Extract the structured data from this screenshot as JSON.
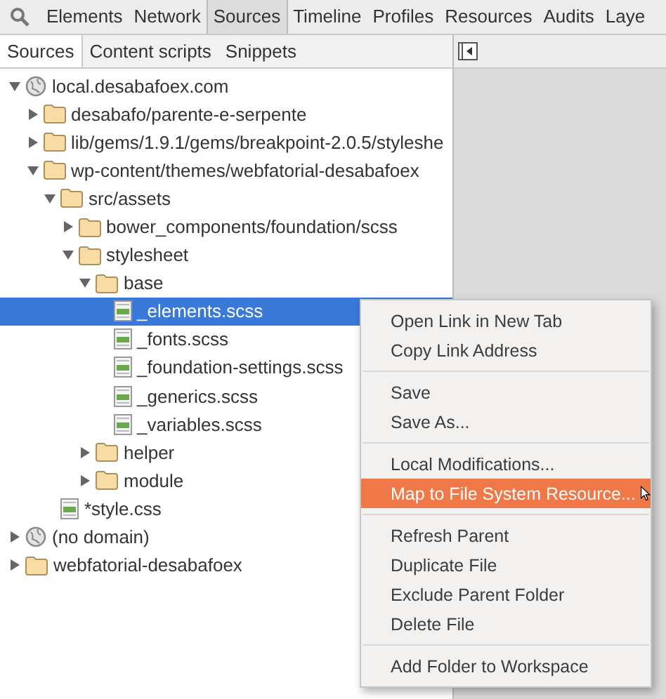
{
  "toolbar": {
    "tabs": [
      {
        "label": "Elements",
        "selected": false
      },
      {
        "label": "Network",
        "selected": false
      },
      {
        "label": "Sources",
        "selected": true
      },
      {
        "label": "Timeline",
        "selected": false
      },
      {
        "label": "Profiles",
        "selected": false
      },
      {
        "label": "Resources",
        "selected": false
      },
      {
        "label": "Audits",
        "selected": false
      },
      {
        "label": "Laye",
        "selected": false
      }
    ]
  },
  "navigator": {
    "tabs": [
      {
        "label": "Sources",
        "selected": true
      },
      {
        "label": "Content scripts",
        "selected": false
      },
      {
        "label": "Snippets",
        "selected": false
      }
    ],
    "tree": [
      {
        "kind": "domain",
        "label": "local.desabafoex.com",
        "expanded": true,
        "selected": false,
        "children": [
          {
            "kind": "folder",
            "label": "desabafo/parente-e-serpente",
            "expanded": false,
            "selected": false
          },
          {
            "kind": "folder",
            "label": "lib/gems/1.9.1/gems/breakpoint-2.0.5/styleshe",
            "expanded": false,
            "selected": false
          },
          {
            "kind": "folder",
            "label": "wp-content/themes/webfatorial-desabafoex",
            "expanded": true,
            "selected": false,
            "children": [
              {
                "kind": "folder",
                "label": "src/assets",
                "expanded": true,
                "selected": false,
                "children": [
                  {
                    "kind": "folder",
                    "label": "bower_components/foundation/scss",
                    "expanded": false,
                    "selected": false
                  },
                  {
                    "kind": "folder",
                    "label": "stylesheet",
                    "expanded": true,
                    "selected": false,
                    "children": [
                      {
                        "kind": "folder",
                        "label": "base",
                        "expanded": true,
                        "selected": false,
                        "children": [
                          {
                            "kind": "file",
                            "label": "_elements.scss",
                            "selected": true
                          },
                          {
                            "kind": "file",
                            "label": "_fonts.scss",
                            "selected": false
                          },
                          {
                            "kind": "file",
                            "label": "_foundation-settings.scss",
                            "selected": false
                          },
                          {
                            "kind": "file",
                            "label": "_generics.scss",
                            "selected": false
                          },
                          {
                            "kind": "file",
                            "label": "_variables.scss",
                            "selected": false
                          }
                        ]
                      },
                      {
                        "kind": "folder",
                        "label": "helper",
                        "expanded": false,
                        "selected": false
                      },
                      {
                        "kind": "folder",
                        "label": "module",
                        "expanded": false,
                        "selected": false
                      }
                    ]
                  }
                ]
              },
              {
                "kind": "file",
                "label": "*style.css",
                "selected": false
              }
            ]
          }
        ]
      },
      {
        "kind": "domain",
        "label": "(no domain)",
        "expanded": false,
        "selected": false
      },
      {
        "kind": "folder",
        "label": "webfatorial-desabafoex",
        "expanded": false,
        "selected": false
      }
    ]
  },
  "context_menu": {
    "groups": [
      [
        {
          "label": "Open Link in New Tab",
          "selected": false
        },
        {
          "label": "Copy Link Address",
          "selected": false
        }
      ],
      [
        {
          "label": "Save",
          "selected": false
        },
        {
          "label": "Save As...",
          "selected": false
        }
      ],
      [
        {
          "label": "Local Modifications...",
          "selected": false
        },
        {
          "label": "Map to File System Resource...",
          "selected": true
        }
      ],
      [
        {
          "label": "Refresh Parent",
          "selected": false
        },
        {
          "label": "Duplicate File",
          "selected": false
        },
        {
          "label": "Exclude Parent Folder",
          "selected": false
        },
        {
          "label": "Delete File",
          "selected": false
        }
      ],
      [
        {
          "label": "Add Folder to Workspace",
          "selected": false
        }
      ]
    ]
  }
}
